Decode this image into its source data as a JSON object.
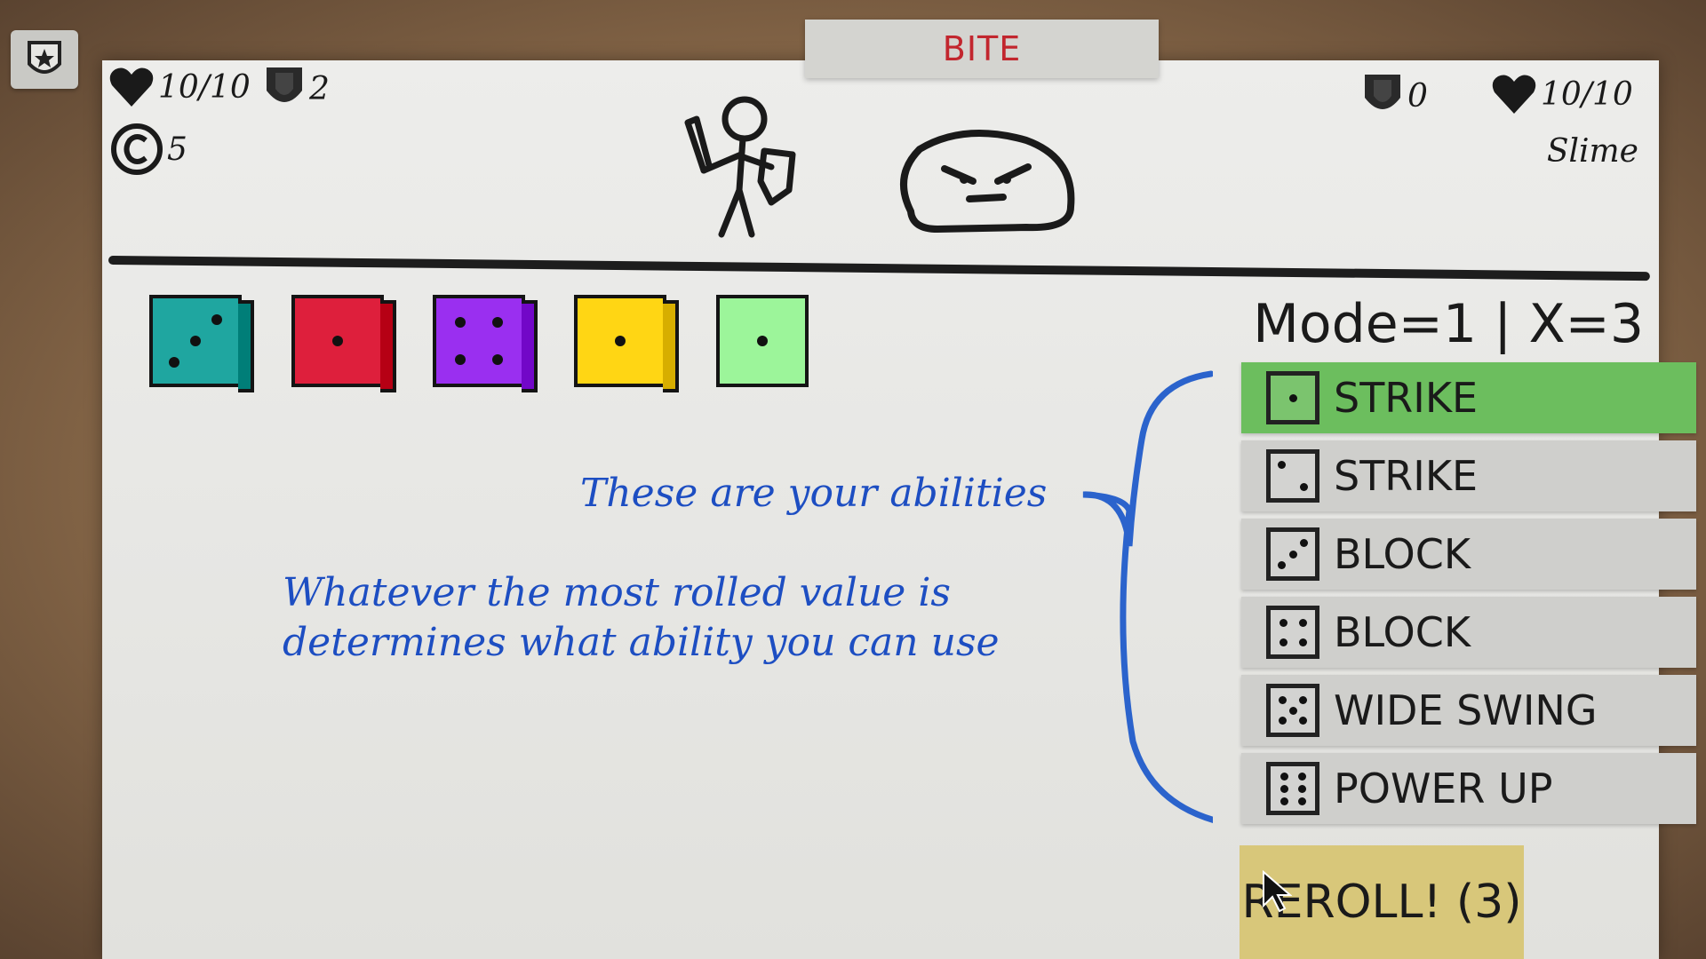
{
  "enemy_intent": "BITE",
  "player": {
    "hp": "10/10",
    "shield": "2",
    "coins": "5"
  },
  "enemy": {
    "name": "Slime",
    "hp": "10/10",
    "shield": "0"
  },
  "mode_text": "Mode=1 | X=3",
  "dice": [
    {
      "color": "#1fa6a0",
      "value": 3
    },
    {
      "color": "#de1f3c",
      "value": 1
    },
    {
      "color": "#9a2ff0",
      "value": 4
    },
    {
      "color": "#ffd614",
      "value": 1
    },
    {
      "color": "#9cf59a",
      "value": 1
    }
  ],
  "tutorial": {
    "line1": "These are your abilities",
    "line2a": "Whatever the most rolled value is",
    "line2b": "determines what ability you can use"
  },
  "abilities": [
    {
      "face": 1,
      "label": "STRIKE",
      "selected": true
    },
    {
      "face": 2,
      "label": "STRIKE",
      "selected": false
    },
    {
      "face": 3,
      "label": "BLOCK",
      "selected": false
    },
    {
      "face": 4,
      "label": "BLOCK",
      "selected": false
    },
    {
      "face": 5,
      "label": "WIDE SWING",
      "selected": false
    },
    {
      "face": 6,
      "label": "POWER UP",
      "selected": false
    }
  ],
  "reroll_label": "REROLL! (3)",
  "colors": {
    "tutorial_ink": "#1d4ec2",
    "selected_ability": "#6cbe5e",
    "reroll_bg": "#d8c77a",
    "intent_text": "#c2262e"
  }
}
